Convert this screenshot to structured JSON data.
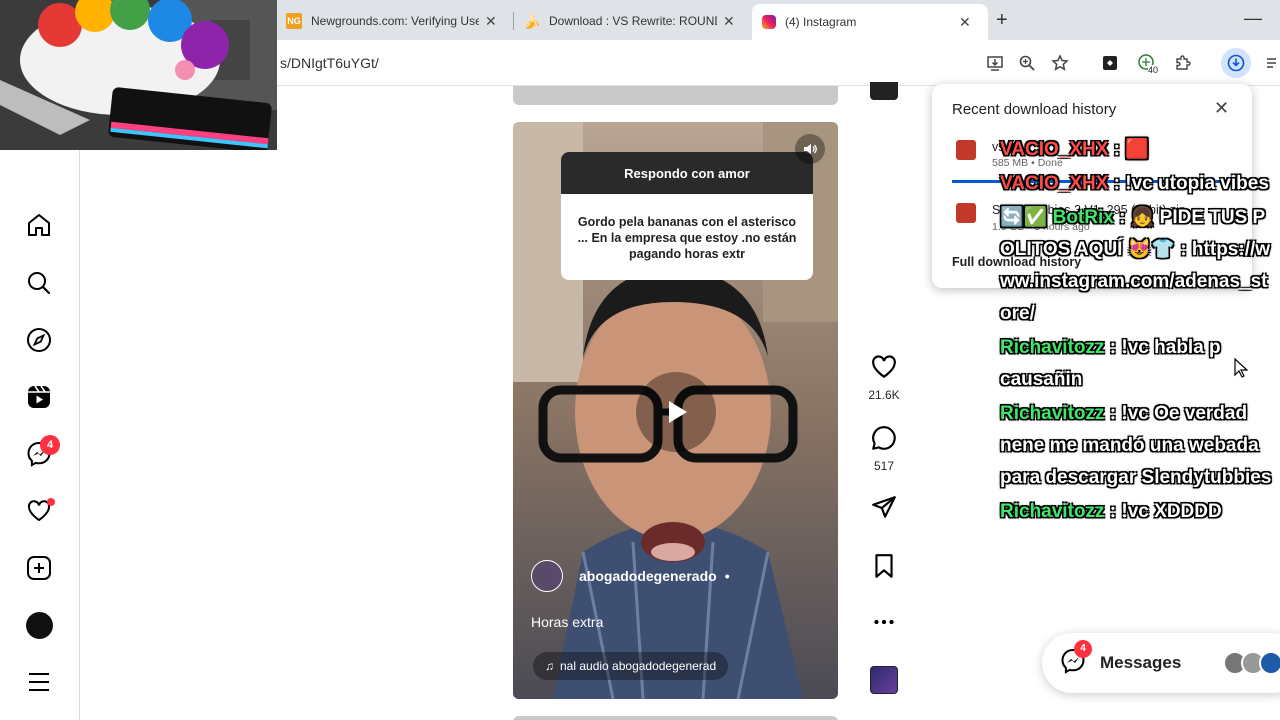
{
  "browser": {
    "tabs": [
      {
        "title": "Newgrounds.com: Verifying Use",
        "favicon": "newgrounds-icon",
        "active": false
      },
      {
        "title": "Download : VS Rewrite: ROUND",
        "favicon": "banana-icon",
        "active": false
      },
      {
        "title": "(4) Instagram",
        "favicon": "instagram-icon",
        "active": true
      }
    ],
    "url": "s/DNIgtT6uYGt/",
    "toolbar_extension_badge": "40"
  },
  "downloads": {
    "title": "Recent download history",
    "items": [
      {
        "name": "vs",
        "meta": "585 MB • Done"
      },
      {
        "name": "Slendytubbies 3 V1_295 (32bit).zip",
        "meta": "1.9 GB • 3 hours ago"
      }
    ],
    "full_history_label": "Full download history"
  },
  "nav": {
    "notifications_badge": "4"
  },
  "reel": {
    "question_title": "Respondo con amor",
    "question_text": "Gordo pela bananas con el asterisco ... En la empresa que estoy .no están pagando horas extr",
    "author": "abogadodegenerado",
    "author_sep": "•",
    "caption": "Horas extra",
    "audio": "nal audio  abogadodegenerad",
    "likes": "21.6K",
    "comments": "517"
  },
  "chat": [
    {
      "user": "VACIO_XHX",
      "text": " : ",
      "color": "red",
      "suffix": "🟥"
    },
    {
      "user": "VACIO_XHX",
      "text": " : !vc utopia vibes",
      "color": "red"
    },
    {
      "user": "BotRix",
      "text": " : 👧 PIDE TUS POLITOS AQUÍ 😻👕 : https://www.instagram.com/adenas_store/",
      "color": "green",
      "prefix": "🔄✅ "
    },
    {
      "user": "Richavitozz",
      "text": " : !vc habla p causañin",
      "color": "green"
    },
    {
      "user": "Richavitozz",
      "text": " : !vc Oe verdad nene me mandó una webada para descargar Slendytubbies",
      "color": "green"
    },
    {
      "user": "Richavitozz",
      "text": " : !vc XDDDD",
      "color": "green"
    }
  ],
  "messages": {
    "label": "Messages",
    "badge": "4"
  }
}
